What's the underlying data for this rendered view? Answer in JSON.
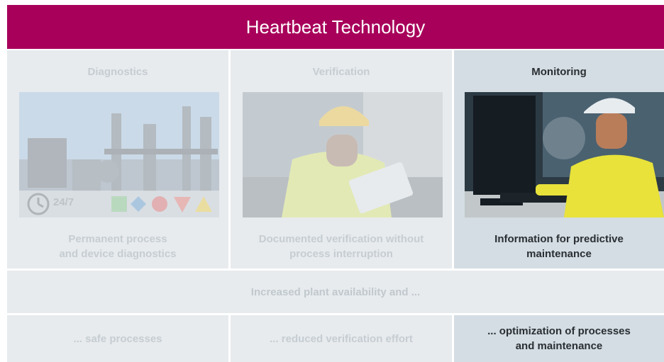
{
  "header": {
    "title": "Heartbeat Technology"
  },
  "columns": [
    {
      "title": "Diagnostics",
      "description": "Permanent process and device diagnostics",
      "line1": "Permanent process",
      "line2": "and device diagnostics",
      "badge": "24/7"
    },
    {
      "title": "Verification",
      "line1": "Documented verification without",
      "line2": "process interruption"
    },
    {
      "title": "Monitoring",
      "line1": "Information for predictive",
      "line2": "maintenance"
    }
  ],
  "band": {
    "text": "Increased plant availability and ..."
  },
  "results": [
    {
      "line1": "... safe processes",
      "line2": ""
    },
    {
      "line1": "... reduced verification effort",
      "line2": ""
    },
    {
      "line1": "... optimization of processes",
      "line2": "and maintenance"
    }
  ],
  "colors": {
    "banner": "#a8005a",
    "panel": "#e7ebee",
    "panel_active": "#d3dde3",
    "icon_check": "#5bb45c",
    "icon_diamond": "#2f7fc4",
    "icon_circle": "#d93636",
    "icon_triangle": "#e64b3c",
    "icon_warning": "#f2c200"
  },
  "icons": [
    "clock-icon",
    "check-status-icon",
    "maintenance-diamond-icon",
    "failure-circle-icon",
    "out-of-spec-triangle-icon",
    "warning-icon"
  ]
}
